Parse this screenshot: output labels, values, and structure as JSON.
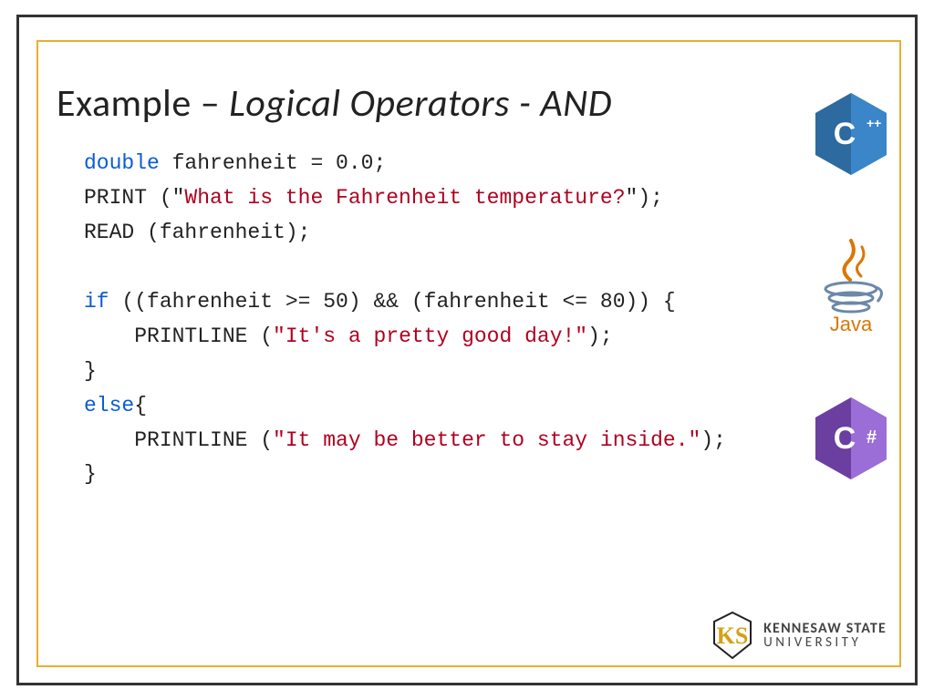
{
  "title": {
    "prefix": "Example – ",
    "italic": "Logical Operators - AND"
  },
  "code": {
    "l1_kw": "double",
    "l1_rest": " fahrenheit = 0.0;",
    "l2_a": "PRINT (\"",
    "l2_str": "What is the Fahrenheit temperature?",
    "l2_b": "\");",
    "l3": "READ (fahrenheit);",
    "l5_kw": "if",
    "l5_rest": " ((fahrenheit >= 50) && (fahrenheit <= 80)) {",
    "l6_a": "    PRINTLINE (",
    "l6_str": "\"It's a pretty good day!\"",
    "l6_b": ");",
    "l7": "}",
    "l8_kw": "else",
    "l8_rest": "{",
    "l9_a": "    PRINTLINE (",
    "l9_str": "\"It may be better to stay inside.\"",
    "l9_b": ");",
    "l10": "}"
  },
  "icons": {
    "cpp": "C++",
    "java": "Java",
    "csharp": "C#"
  },
  "footer": {
    "name1": "KENNESAW STATE",
    "name2": "UNIVERSITY"
  },
  "colors": {
    "keyword": "#0b5cd6",
    "string": "#b00020",
    "accent": "#e8af2f"
  }
}
